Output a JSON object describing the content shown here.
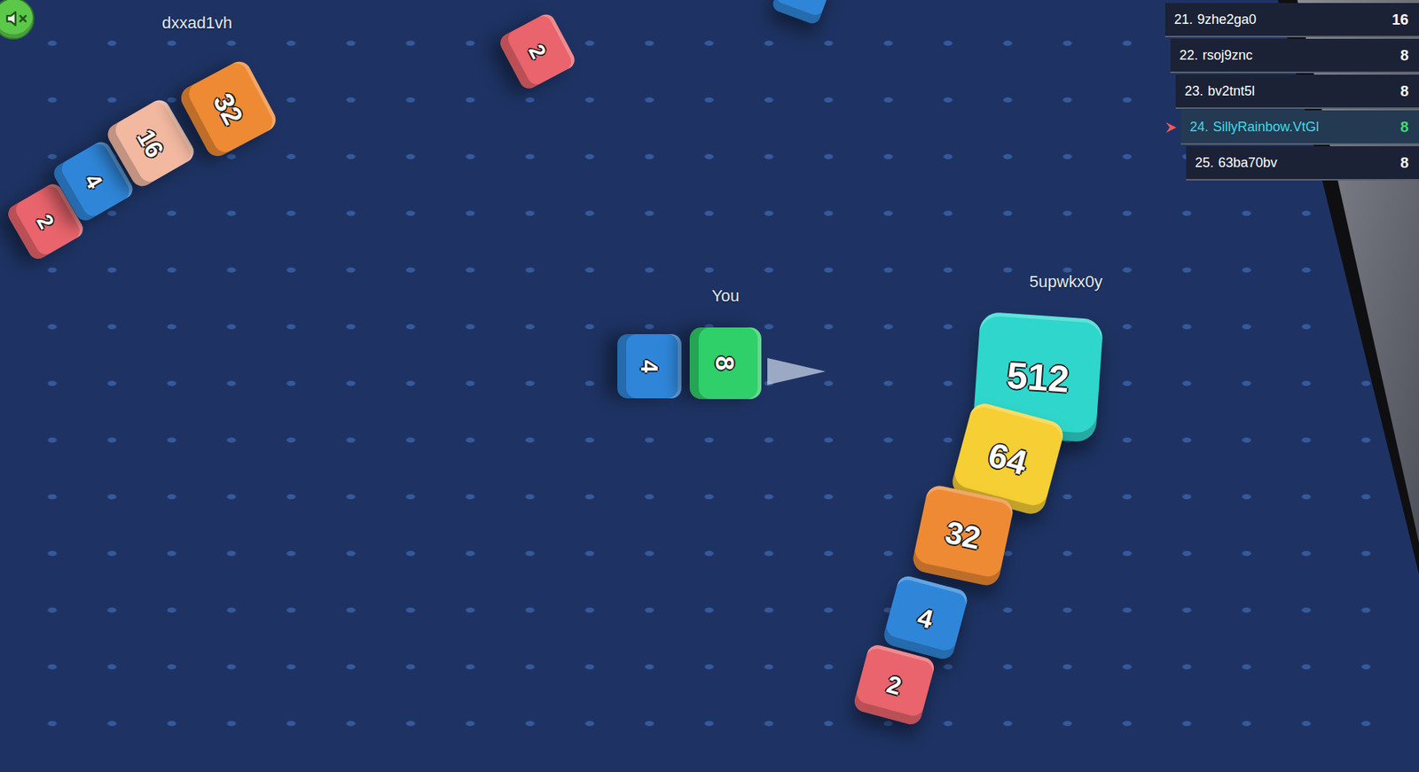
{
  "sound": {
    "muted": true
  },
  "leaderboard": [
    {
      "rank": "21.",
      "name": "9zhe2ga0",
      "score": "16",
      "selected": false
    },
    {
      "rank": "22.",
      "name": "rsoj9znc",
      "score": "8",
      "selected": false
    },
    {
      "rank": "23.",
      "name": "bv2tnt5l",
      "score": "8",
      "selected": false
    },
    {
      "rank": "24.",
      "name": "SillyRainbow.VtGl",
      "score": "8",
      "selected": true
    },
    {
      "rank": "25.",
      "name": "63ba70bv",
      "score": "8",
      "selected": false
    }
  ],
  "players": [
    {
      "name": "dxxad1vh",
      "cubes": [
        {
          "value": "2",
          "color": "#e9646c"
        },
        {
          "value": "4",
          "color": "#2f86d9"
        },
        {
          "value": "16",
          "color": "#f2b8a0"
        },
        {
          "value": "32",
          "color": "#ee8a34"
        }
      ]
    },
    {
      "name": "You",
      "cubes": [
        {
          "value": "4",
          "color": "#2f86d9"
        },
        {
          "value": "8",
          "color": "#2fcf6a"
        }
      ]
    },
    {
      "name": "5upwkx0y",
      "cubes": [
        {
          "value": "512",
          "color": "#2fd6cc"
        },
        {
          "value": "64",
          "color": "#f5cf34"
        },
        {
          "value": "32",
          "color": "#ee8a34"
        },
        {
          "value": "4",
          "color": "#2f86d9"
        },
        {
          "value": "2",
          "color": "#e9646c"
        }
      ]
    }
  ],
  "loose_cubes": [
    {
      "value": "2",
      "color": "#e9646c"
    },
    {
      "value": "",
      "color": "#2f86d9"
    }
  ]
}
